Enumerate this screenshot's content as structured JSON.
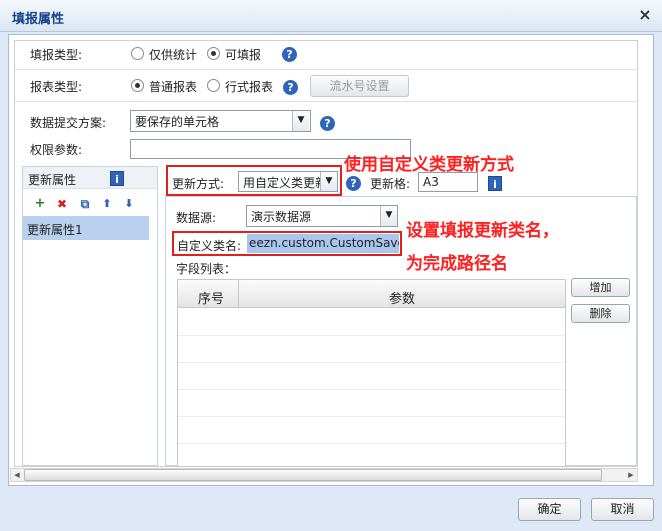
{
  "dialog": {
    "title": "填报属性",
    "close_glyph": "×"
  },
  "fill_type": {
    "label": "填报类型:",
    "options": [
      "仅供统计",
      "可填报"
    ],
    "selected": "可填报"
  },
  "report_type": {
    "label": "报表类型:",
    "options": [
      "普通报表",
      "行式报表"
    ],
    "selected": "普通报表",
    "serial_button": "流水号设置"
  },
  "submit_plan": {
    "label": "数据提交方案:",
    "value": "要保存的单元格"
  },
  "permission": {
    "label": "权限参数:",
    "value": ""
  },
  "update_props": {
    "panel_title": "更新属性",
    "toolbar": {
      "add": "+",
      "delete": "✖",
      "copy": "⧉",
      "up": "⬆",
      "down": "⬇"
    },
    "items": [
      "更新属性1"
    ]
  },
  "update_mode": {
    "label": "更新方式:",
    "value": "用自定义类更新",
    "cell_label": "更新格:",
    "cell_value": "A3"
  },
  "datasource": {
    "label": "数据源:",
    "value": "演示数据源"
  },
  "custom_class": {
    "label": "自定义类名:",
    "value": "eezn.custom.CustomSaver"
  },
  "fields": {
    "label": "字段列表：",
    "columns": [
      "序号",
      "参数"
    ],
    "add_button": "增加",
    "delete_button": "删除"
  },
  "annotations": {
    "update_mode": "使用自定义类更新方式",
    "class_line1": "设置填报更新类名，",
    "class_line2": "为完成路径名"
  },
  "footer": {
    "ok": "确定",
    "cancel": "取消"
  },
  "colors": {
    "annotation_red": "#e02020",
    "title_blue": "#15428b",
    "help_blue": "#2f64b8"
  },
  "icons": {
    "help": "?",
    "info": "i",
    "arrow_down": "▼",
    "scroll_left": "◀",
    "scroll_right": "▶"
  }
}
